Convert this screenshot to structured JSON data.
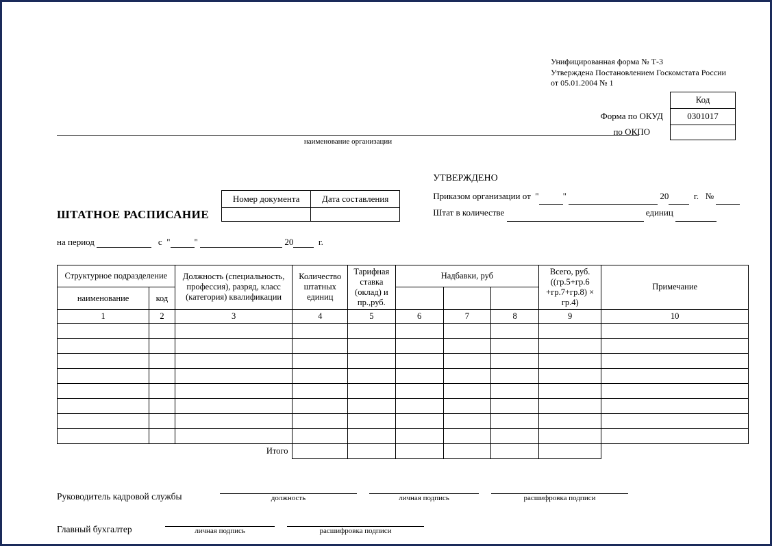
{
  "header": {
    "form_line1": "Унифицированная форма № Т-3",
    "form_line2": "Утверждена Постановлением Госкомстата России",
    "form_line3": "от 05.01.2004 № 1",
    "code_header": "Код",
    "okud_label": "Форма по ОКУД",
    "okud_value": "0301017",
    "okpo_label": "по ОКПО",
    "okpo_value": ""
  },
  "org": {
    "caption": "наименование организации"
  },
  "doc": {
    "title": "ШТАТНОЕ РАСПИСАНИЕ",
    "num_label": "Номер документа",
    "date_label": "Дата составления",
    "num_value": "",
    "date_value": ""
  },
  "approve": {
    "title": "УТВЕРЖДЕНО",
    "order_text_1": "Приказом организации от",
    "quote": "\"",
    "year_prefix": "20",
    "year_suffix": "г.",
    "num_sign": "№",
    "staff_text_1": "Штат в количестве",
    "staff_text_2": "единиц"
  },
  "period": {
    "label_1": "на период",
    "label_2": "с",
    "quote": "\"",
    "year_prefix": "20",
    "year_suffix": "г."
  },
  "table": {
    "h_struct": "Структурное подразделение",
    "h_name": "наименование",
    "h_code": "код",
    "h_position": "Должность (специальность, профессия), разряд, класс (категория) квалификации",
    "h_units": "Количество штатных единиц",
    "h_tariff": "Тарифная ставка (оклад) и пр.,руб.",
    "h_allowance": "Надбавки, руб",
    "h_total": "Всего, руб. ((гр.5+гр.6 +гр.7+гр.8) × гр.4)",
    "h_note": "Примечание",
    "col1": "1",
    "col2": "2",
    "col3": "3",
    "col4": "4",
    "col5": "5",
    "col6": "6",
    "col7": "7",
    "col8": "8",
    "col9": "9",
    "col10": "10",
    "itogo": "Итого"
  },
  "signatures": {
    "hr_head": "Руководитель кадровой службы",
    "chief_acc": "Главный бухгалтер",
    "cap_position": "должность",
    "cap_signature": "личная подпись",
    "cap_decode": "расшифровка подписи"
  }
}
